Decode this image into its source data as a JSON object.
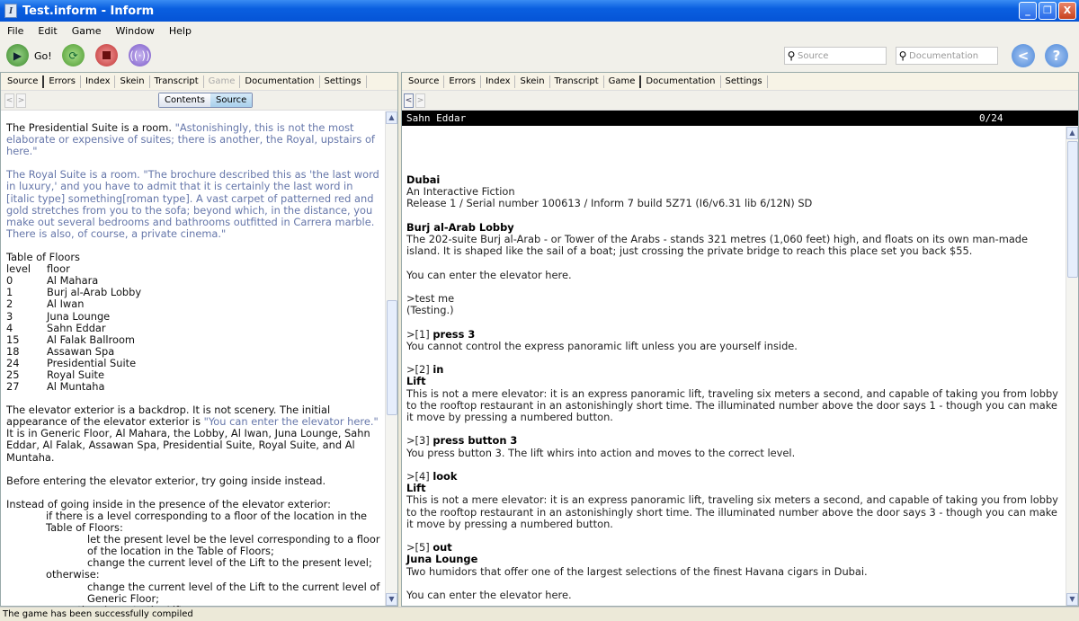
{
  "window": {
    "title": "Test.inform - Inform",
    "minimize": "_",
    "restore": "❐",
    "close": "X"
  },
  "menu": [
    "File",
    "Edit",
    "Game",
    "Window",
    "Help"
  ],
  "toolbar": {
    "go": "Go!",
    "search_source": "Source",
    "search_docs": "Documentation",
    "back": "<",
    "help": "?"
  },
  "left": {
    "tabs": [
      "Source",
      "Errors",
      "Index",
      "Skein",
      "Transcript",
      "Game",
      "Documentation",
      "Settings"
    ],
    "active_tab": "Source",
    "disabled_tab": "Game",
    "seg": [
      "Contents",
      "Source"
    ],
    "paragraphs": [
      [
        {
          "t": "The Presidential Suite is a room. "
        },
        {
          "t": "\"Astonishingly, this is not the most elaborate or expensive of suites; there is another, the Royal, upstairs of here.\"",
          "q": true
        }
      ],
      [
        {
          "t": "The Royal Suite is a room. \"The brochure described this as 'the last word in luxury,' and you have to admit that it is certainly the last word in ",
          "q": true
        },
        {
          "t": "[italic type]",
          "q": true
        },
        {
          "t": " something",
          "q": true
        },
        {
          "t": "[roman type]",
          "q": true
        },
        {
          "t": ". A vast carpet of patterned red and gold stretches from you to the sofa; beyond which, in the distance, you make out several bedrooms and bathrooms outfitted in Carrera marble. There is also, of course, a private cinema.\"",
          "q": true
        }
      ]
    ],
    "table": {
      "title": "Table of Floors",
      "headers": [
        "level",
        "floor"
      ],
      "rows": [
        [
          "0",
          "Al Mahara"
        ],
        [
          "1",
          "Burj al-Arab Lobby"
        ],
        [
          "2",
          "Al Iwan"
        ],
        [
          "3",
          "Juna Lounge"
        ],
        [
          "4",
          "Sahn Eddar"
        ],
        [
          "15",
          "Al Falak Ballroom"
        ],
        [
          "18",
          "Assawan Spa"
        ],
        [
          "24",
          "Presidential Suite"
        ],
        [
          "25",
          "Royal Suite"
        ],
        [
          "27",
          "Al Muntaha"
        ]
      ]
    },
    "paragraphs2": [
      [
        {
          "t": "The elevator exterior is a backdrop. It is not scenery. The initial appearance of the elevator exterior is "
        },
        {
          "t": "\"You can enter the elevator here.\"",
          "q": true
        },
        {
          "t": " It is in Generic Floor, Al Mahara, the Lobby, Al Iwan, Juna Lounge, Sahn Eddar, Al Falak, Assawan Spa, Presidential Suite, Royal Suite, and Al Muntaha."
        }
      ],
      [
        {
          "t": "Before entering the elevator exterior, try going inside instead."
        }
      ]
    ],
    "rule": [
      {
        "t": "Instead of going inside in the presence of the elevator exterior:",
        "i": 0
      },
      {
        "t": "if there is a level corresponding to a floor of the location in the Table of Floors:",
        "i": 1
      },
      {
        "t": "let the present level be the level corresponding to a floor of the location in the Table of Floors;",
        "i": 2
      },
      {
        "t": "change the current level of the Lift to the present level;",
        "i": 2
      },
      {
        "t": "otherwise:",
        "i": 1
      },
      {
        "t": "change the current level of the Lift to the current level of Generic Floor;",
        "i": 2
      },
      {
        "t": "move the player to the Lift.",
        "i": 1
      }
    ]
  },
  "right": {
    "tabs": [
      "Source",
      "Errors",
      "Index",
      "Skein",
      "Transcript",
      "Game",
      "Documentation",
      "Settings"
    ],
    "active_tab": "Game",
    "status_location": "Sahn Eddar",
    "status_score": "0/24",
    "transcript": [
      [
        {
          "b": "Dubai"
        },
        {
          "t": "An Interactive Fiction"
        },
        {
          "t": "Release 1 / Serial number 100613 / Inform 7 build 5Z71 (I6/v6.31 lib 6/12N) SD"
        }
      ],
      [
        {
          "b": "Burj al-Arab Lobby"
        },
        {
          "t": "The 202-suite Burj al-Arab - or Tower of the Arabs - stands 321 metres (1,060 feet) high, and floats on its own man-made island. It is shaped like the sail of a boat; just crossing the private bridge to reach this place set you back $55."
        }
      ],
      [
        {
          "t": "You can enter the elevator here."
        }
      ],
      [
        {
          "t": ">test me"
        },
        {
          "t": "(Testing.)"
        }
      ],
      [
        {
          "p": ">[1] ",
          "b": "press 3"
        },
        {
          "t": "You cannot control the express panoramic lift unless you are yourself inside."
        }
      ],
      [
        {
          "p": ">[2] ",
          "b": "in"
        },
        {
          "b": "Lift"
        },
        {
          "t": "This is not a mere elevator: it is an express panoramic lift, traveling six meters a second, and capable of taking you from lobby to the rooftop restaurant in an astonishingly short time. The illuminated number above the door says 1 - though you can make it move by pressing a numbered button."
        }
      ],
      [
        {
          "p": ">[3] ",
          "b": "press button 3"
        },
        {
          "t": "You press button 3. The lift whirs into action and moves to the correct level."
        }
      ],
      [
        {
          "p": ">[4] ",
          "b": "look"
        },
        {
          "b": "Lift"
        },
        {
          "t": "This is not a mere elevator: it is an express panoramic lift, traveling six meters a second, and capable of taking you from lobby to the rooftop restaurant in an astonishingly short time. The illuminated number above the door says 3 - though you can make it move by pressing a numbered button."
        }
      ],
      [
        {
          "p": ">[5] ",
          "b": "out"
        },
        {
          "b": "Juna Lounge"
        },
        {
          "t": "Two humidors that offer one of the largest selections of the finest Havana cigars in Dubai."
        }
      ],
      [
        {
          "t": "You can enter the elevator here."
        }
      ]
    ]
  },
  "statusbar": "The game has been successfully compiled"
}
